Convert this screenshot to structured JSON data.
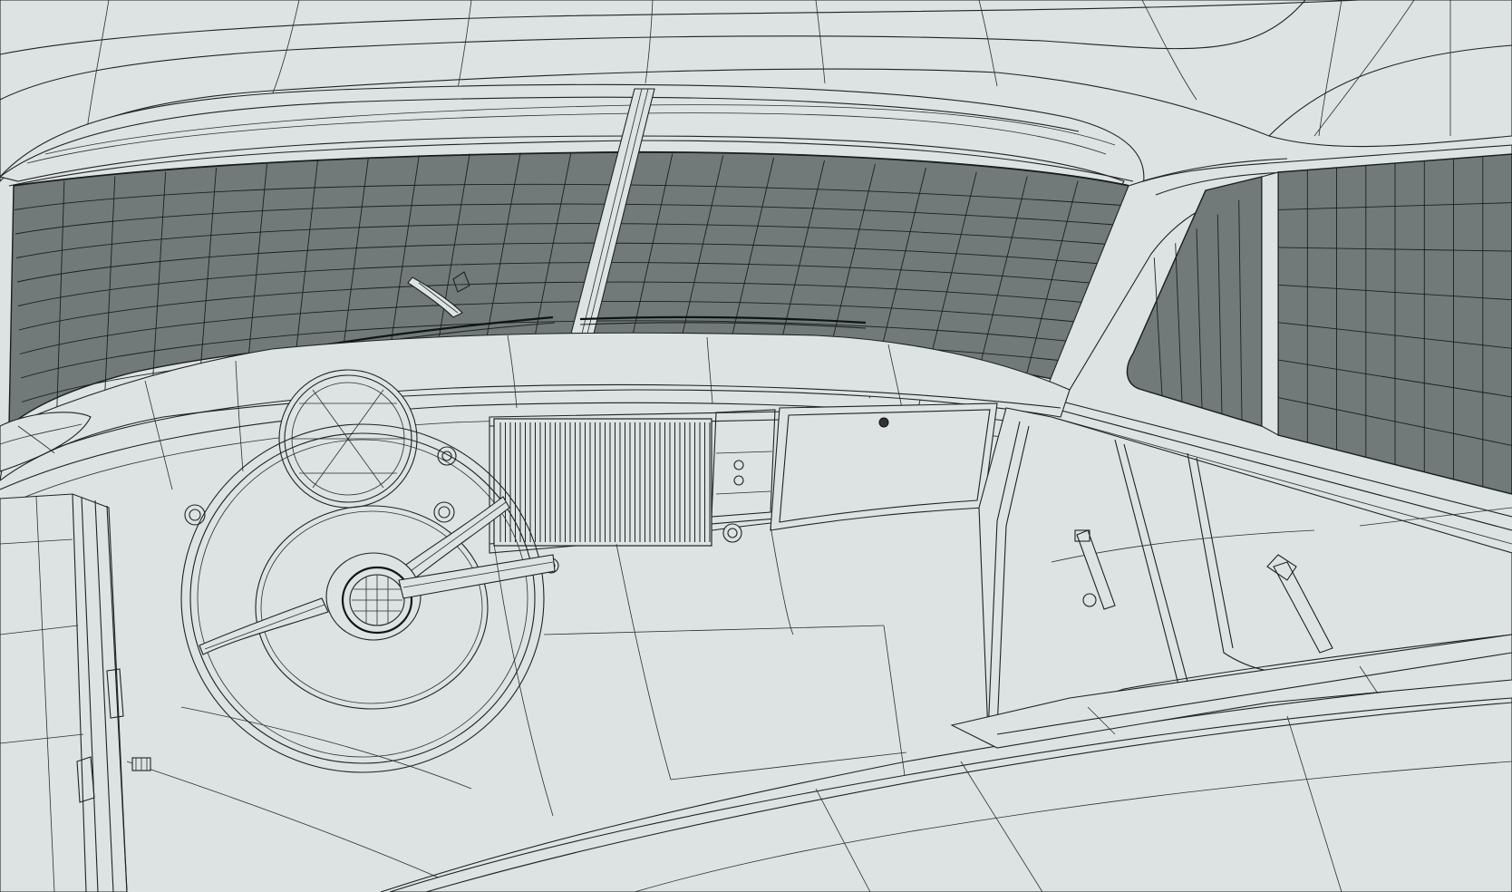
{
  "scene": {
    "subject": "wireframe-car-interior",
    "colors": {
      "background": "#dde2e2",
      "glass": "#727979",
      "wire": "#1e2222"
    },
    "icons": {
      "steering_wheel": "steering-wheel-icon",
      "gauge": "speedometer-icon",
      "door_handle": "door-handle-icon"
    }
  }
}
